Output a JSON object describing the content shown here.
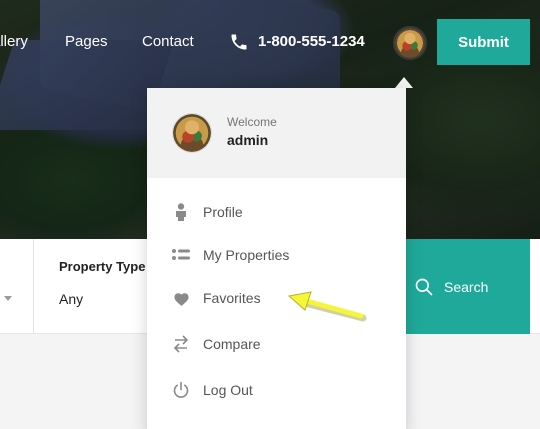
{
  "nav": {
    "links": [
      "allery",
      "Pages",
      "Contact"
    ],
    "phone": "1-800-555-1234",
    "phone_icon": "phone-icon",
    "submit_label": "Submit"
  },
  "search": {
    "field_label": "Property Type",
    "field_value": "Any",
    "button_label": "Search",
    "button_icon": "search-icon"
  },
  "user_menu": {
    "welcome": "Welcome",
    "username": "admin",
    "items": [
      {
        "label": "Profile",
        "icon": "user-icon"
      },
      {
        "label": "My Properties",
        "icon": "list-icon"
      },
      {
        "label": "Favorites",
        "icon": "heart-icon"
      },
      {
        "label": "Compare",
        "icon": "compare-arrows-icon"
      },
      {
        "label": "Log Out",
        "icon": "power-icon"
      }
    ]
  },
  "colors": {
    "accent": "#1fa99a",
    "annotation_arrow": "#f5f53a"
  }
}
